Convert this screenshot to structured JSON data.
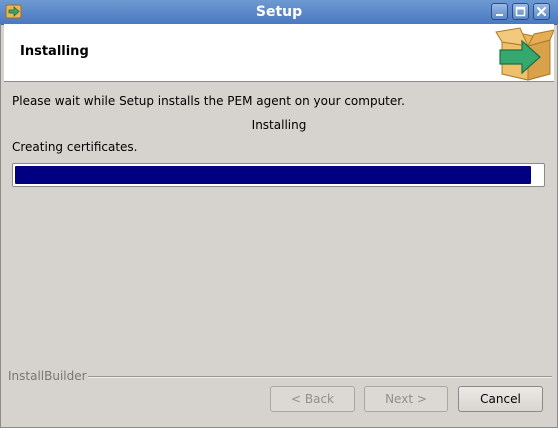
{
  "window": {
    "title": "Setup",
    "icon": "setup-arrow-icon",
    "controls": [
      "minimize-icon",
      "maximize-icon",
      "close-icon"
    ]
  },
  "header": {
    "title": "Installing",
    "logo_icon": "box-arrow-icon"
  },
  "content": {
    "message": "Please wait while Setup installs the PEM agent on your computer.",
    "status_heading": "Installing",
    "step_text": "Creating certificates.",
    "progress_fraction": 0.98
  },
  "footer": {
    "brand": "InstallBuilder",
    "back_label": "< Back",
    "next_label": "Next >",
    "cancel_label": "Cancel"
  },
  "colors": {
    "titlebar": "#4a79c0",
    "progress_fill": "#000080",
    "background": "#d6d2cd"
  }
}
